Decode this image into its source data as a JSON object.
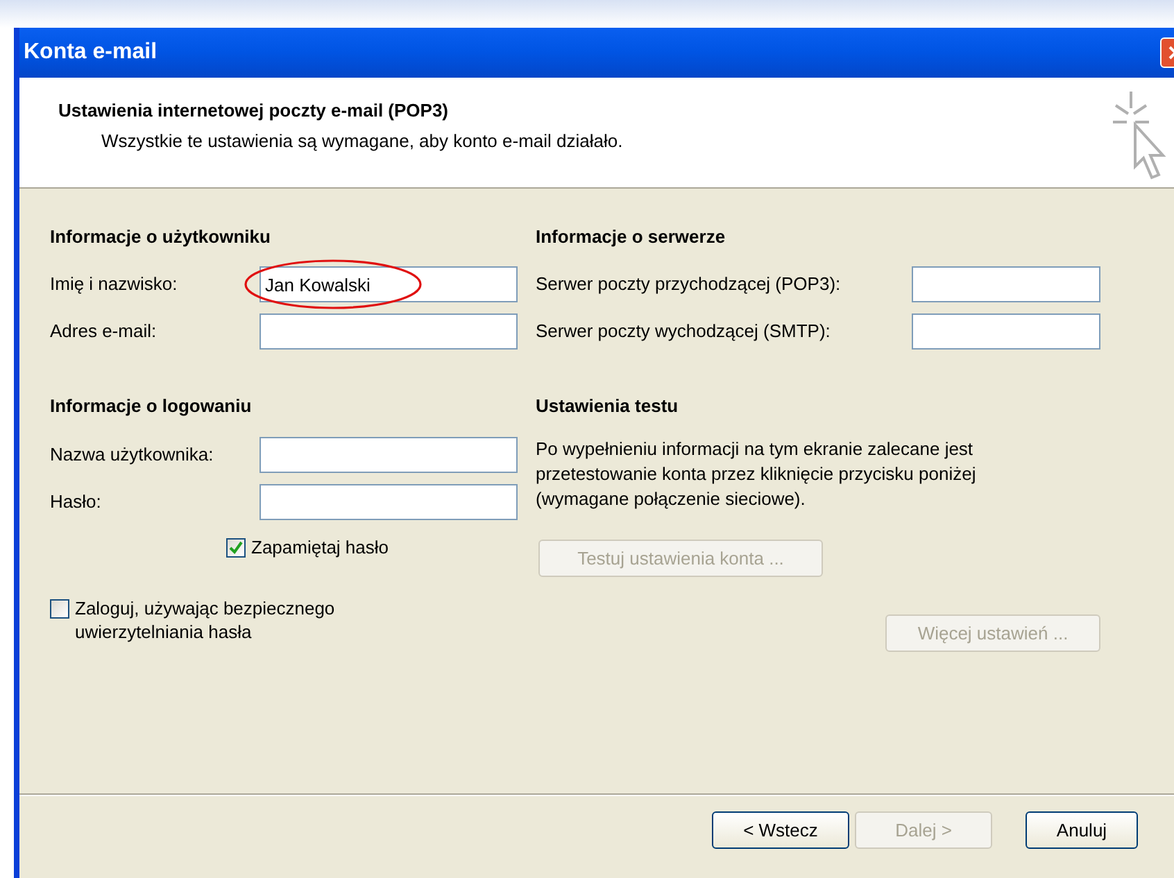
{
  "window": {
    "title": "Konta e-mail"
  },
  "header": {
    "title": "Ustawienia internetowej poczty e-mail (POP3)",
    "subtitle": "Wszystkie te ustawienia są wymagane, aby konto e-mail działało."
  },
  "user_info": {
    "heading": "Informacje o użytkowniku",
    "fields": [
      {
        "label": "Imię i nazwisko:",
        "value": "Jan Kowalski",
        "focused": true
      },
      {
        "label": "Adres e-mail:",
        "focused": false
      }
    ]
  },
  "server_info": {
    "heading": "Informacje o serwerze",
    "fields": [
      {
        "label": "Serwer poczty przychodzącej (POP3):"
      },
      {
        "label": "Serwer poczty wychodzącej (SMTP):"
      }
    ]
  },
  "login_info": {
    "heading": "Informacje o logowaniu",
    "fields": [
      {
        "label": "Nazwa użytkownika:"
      },
      {
        "label": "Hasło:"
      }
    ],
    "remember": {
      "label": "Zapamiętaj hasło",
      "checked": true
    },
    "secure": {
      "label": "Zaloguj, używając bezpiecznego uwierzytelniania hasła",
      "checked": false
    }
  },
  "test_settings": {
    "heading": "Ustawienia testu",
    "text": "Po wypełnieniu informacji na tym ekranie zalecane jest przetestowanie konta przez kliknięcie przycisku poniżej (wymagane połączenie sieciowe).",
    "button": {
      "label": "Testuj ustawienia konta ...",
      "disabled": true
    }
  },
  "more_settings": {
    "label": "Więcej ustawień ...",
    "disabled": true
  },
  "footer_buttons": [
    {
      "label": "< Wstecz",
      "disabled": false
    },
    {
      "label": "Dalej >",
      "disabled": true
    },
    {
      "label": "Anuluj",
      "disabled": false
    }
  ]
}
